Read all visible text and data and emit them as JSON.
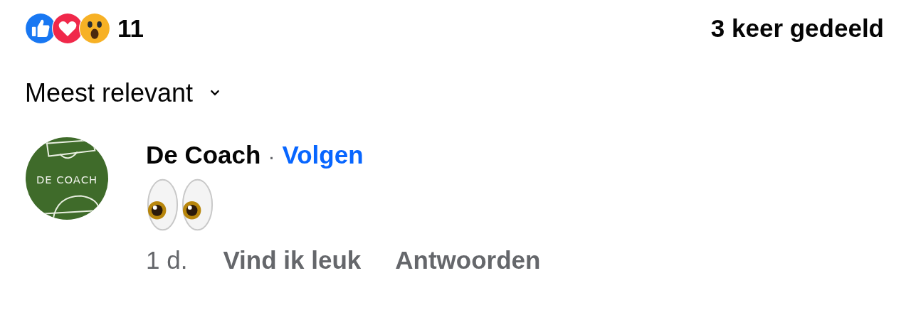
{
  "reactions": {
    "icons": [
      {
        "kind": "like"
      },
      {
        "kind": "love"
      },
      {
        "kind": "wow"
      }
    ],
    "count": "11"
  },
  "shares": "3 keer gedeeld",
  "sort": {
    "label": "Meest relevant"
  },
  "comments": [
    {
      "avatar_text": "DE COACH",
      "author": "De Coach",
      "separator": "·",
      "follow": "Volgen",
      "content": {
        "kind": "eyes"
      },
      "time": "1 d.",
      "actions": [
        "Vind ik leuk",
        "Antwoorden"
      ]
    }
  ]
}
